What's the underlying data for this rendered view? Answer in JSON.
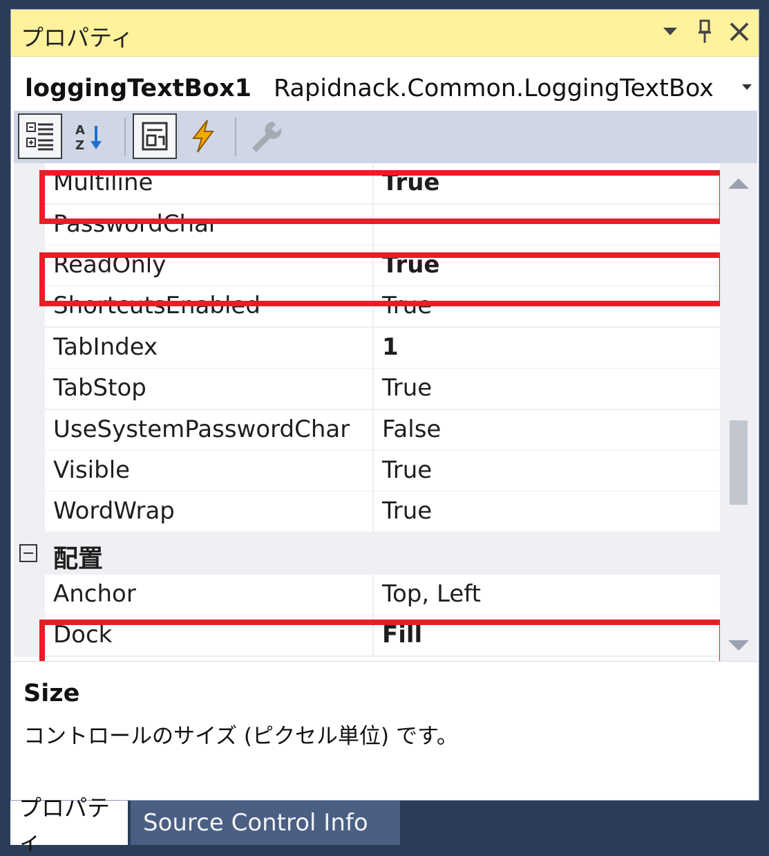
{
  "window": {
    "title": "プロパティ",
    "icons": {
      "dropdown": "chevron-down-icon",
      "pin": "pin-icon",
      "close": "close-icon"
    }
  },
  "object_selector": {
    "name": "loggingTextBox1",
    "type": "Rapidnack.Common.LoggingTextBox"
  },
  "toolbar": {
    "buttons": [
      "categorized-icon",
      "alphabetical-icon",
      "properties-icon",
      "events-icon",
      "property-pages-icon"
    ]
  },
  "properties": {
    "rows": [
      {
        "name": "Multiline",
        "value": "True"
      },
      {
        "name": "PasswordChar",
        "value": ""
      },
      {
        "name": "ReadOnly",
        "value": "True"
      },
      {
        "name": "ShortcutsEnabled",
        "value": "True"
      },
      {
        "name": "TabIndex",
        "value": "1"
      },
      {
        "name": "TabStop",
        "value": "True"
      },
      {
        "name": "UseSystemPasswordChar",
        "value": "False"
      },
      {
        "name": "Visible",
        "value": "True"
      },
      {
        "name": "WordWrap",
        "value": "True"
      }
    ],
    "category": {
      "label": "配置"
    },
    "layout_rows": [
      {
        "name": "Anchor",
        "value": "Top, Left"
      },
      {
        "name": "Dock",
        "value": "Fill"
      }
    ],
    "highlighted": [
      "Multiline",
      "ReadOnly",
      "Dock"
    ],
    "highlight_color": "#e61e27"
  },
  "description": {
    "title": "Size",
    "text": "コントロールのサイズ (ピクセル単位) です。"
  },
  "tabs": {
    "properties": "プロパティ",
    "source_control": "Source Control Info"
  },
  "colors": {
    "titlebar": "#fff29d",
    "frame": "#2b3c59",
    "toolbar": "#cfd6e5",
    "inactive_tab": "#4a5f82"
  }
}
